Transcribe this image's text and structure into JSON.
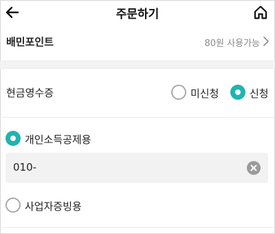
{
  "header": {
    "title": "주문하기",
    "back_icon": "arrow-left-icon",
    "home_icon": "home-icon"
  },
  "points": {
    "label": "배민포인트",
    "value": "80원 사용가능"
  },
  "receipt": {
    "label": "현금영수증",
    "options": [
      {
        "label": "미신청",
        "selected": false
      },
      {
        "label": "신청",
        "selected": true
      }
    ]
  },
  "receipt_type": {
    "options": [
      {
        "label": "개인소득공제용",
        "selected": true
      },
      {
        "label": "사업자증빙용",
        "selected": false
      }
    ]
  },
  "phone": {
    "value": "010-"
  },
  "colors": {
    "accent": "#20b4b0"
  }
}
